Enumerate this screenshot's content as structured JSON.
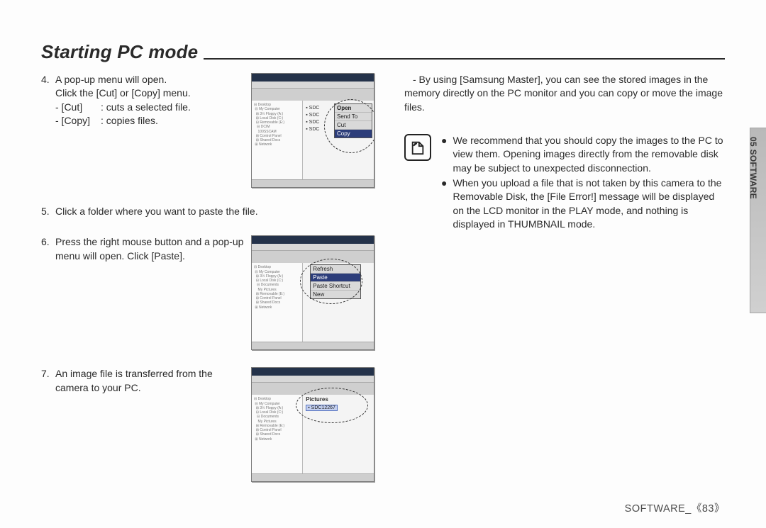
{
  "header": {
    "title": "Starting PC mode"
  },
  "steps": {
    "s4": {
      "num": "4.",
      "l1": "A pop-up menu will open.",
      "l2": "Click the [Cut] or [Copy] menu.",
      "d1k": "- [Cut]",
      "d1v": ": cuts a selected file.",
      "d2k": "- [Copy]",
      "d2v": ": copies files."
    },
    "s5": {
      "num": "5.",
      "text": "Click a folder where you want to paste the file."
    },
    "s6": {
      "num": "6.",
      "text": "Press the right mouse button and a pop-up menu will open. Click [Paste]."
    },
    "s7": {
      "num": "7.",
      "text": "An image file is transferred from the camera to your PC."
    }
  },
  "right": {
    "para": "- By using [Samsung Master], you can see the stored images in the memory directly on the PC monitor and you can copy or move the image files."
  },
  "note": {
    "b1": "We recommend that you should copy the images to the PC to view them. Opening images directly from the removable disk may be subject to unexpected disconnection.",
    "b2": "When you upload a file that is not taken by this camera to the Removable Disk, the [File Error!] message will be displayed on the LCD monitor in the PLAY mode, and nothing is displayed in THUMBNAIL mode."
  },
  "thumbs": {
    "t1": {
      "files": [
        "SDC",
        "SDC",
        "SDC",
        "SDC"
      ],
      "menu": [
        "Open",
        "Send To",
        "Cut",
        "Copy"
      ]
    },
    "t2": {
      "menu": [
        "Refresh",
        "Paste",
        "Paste Shortcut",
        "New"
      ]
    },
    "t3": {
      "head": "Pictures",
      "file": "SDC12267"
    }
  },
  "sidebar_tab": "05 SOFTWARE",
  "footer": {
    "label": "SOFTWARE_",
    "page": "《83》"
  }
}
